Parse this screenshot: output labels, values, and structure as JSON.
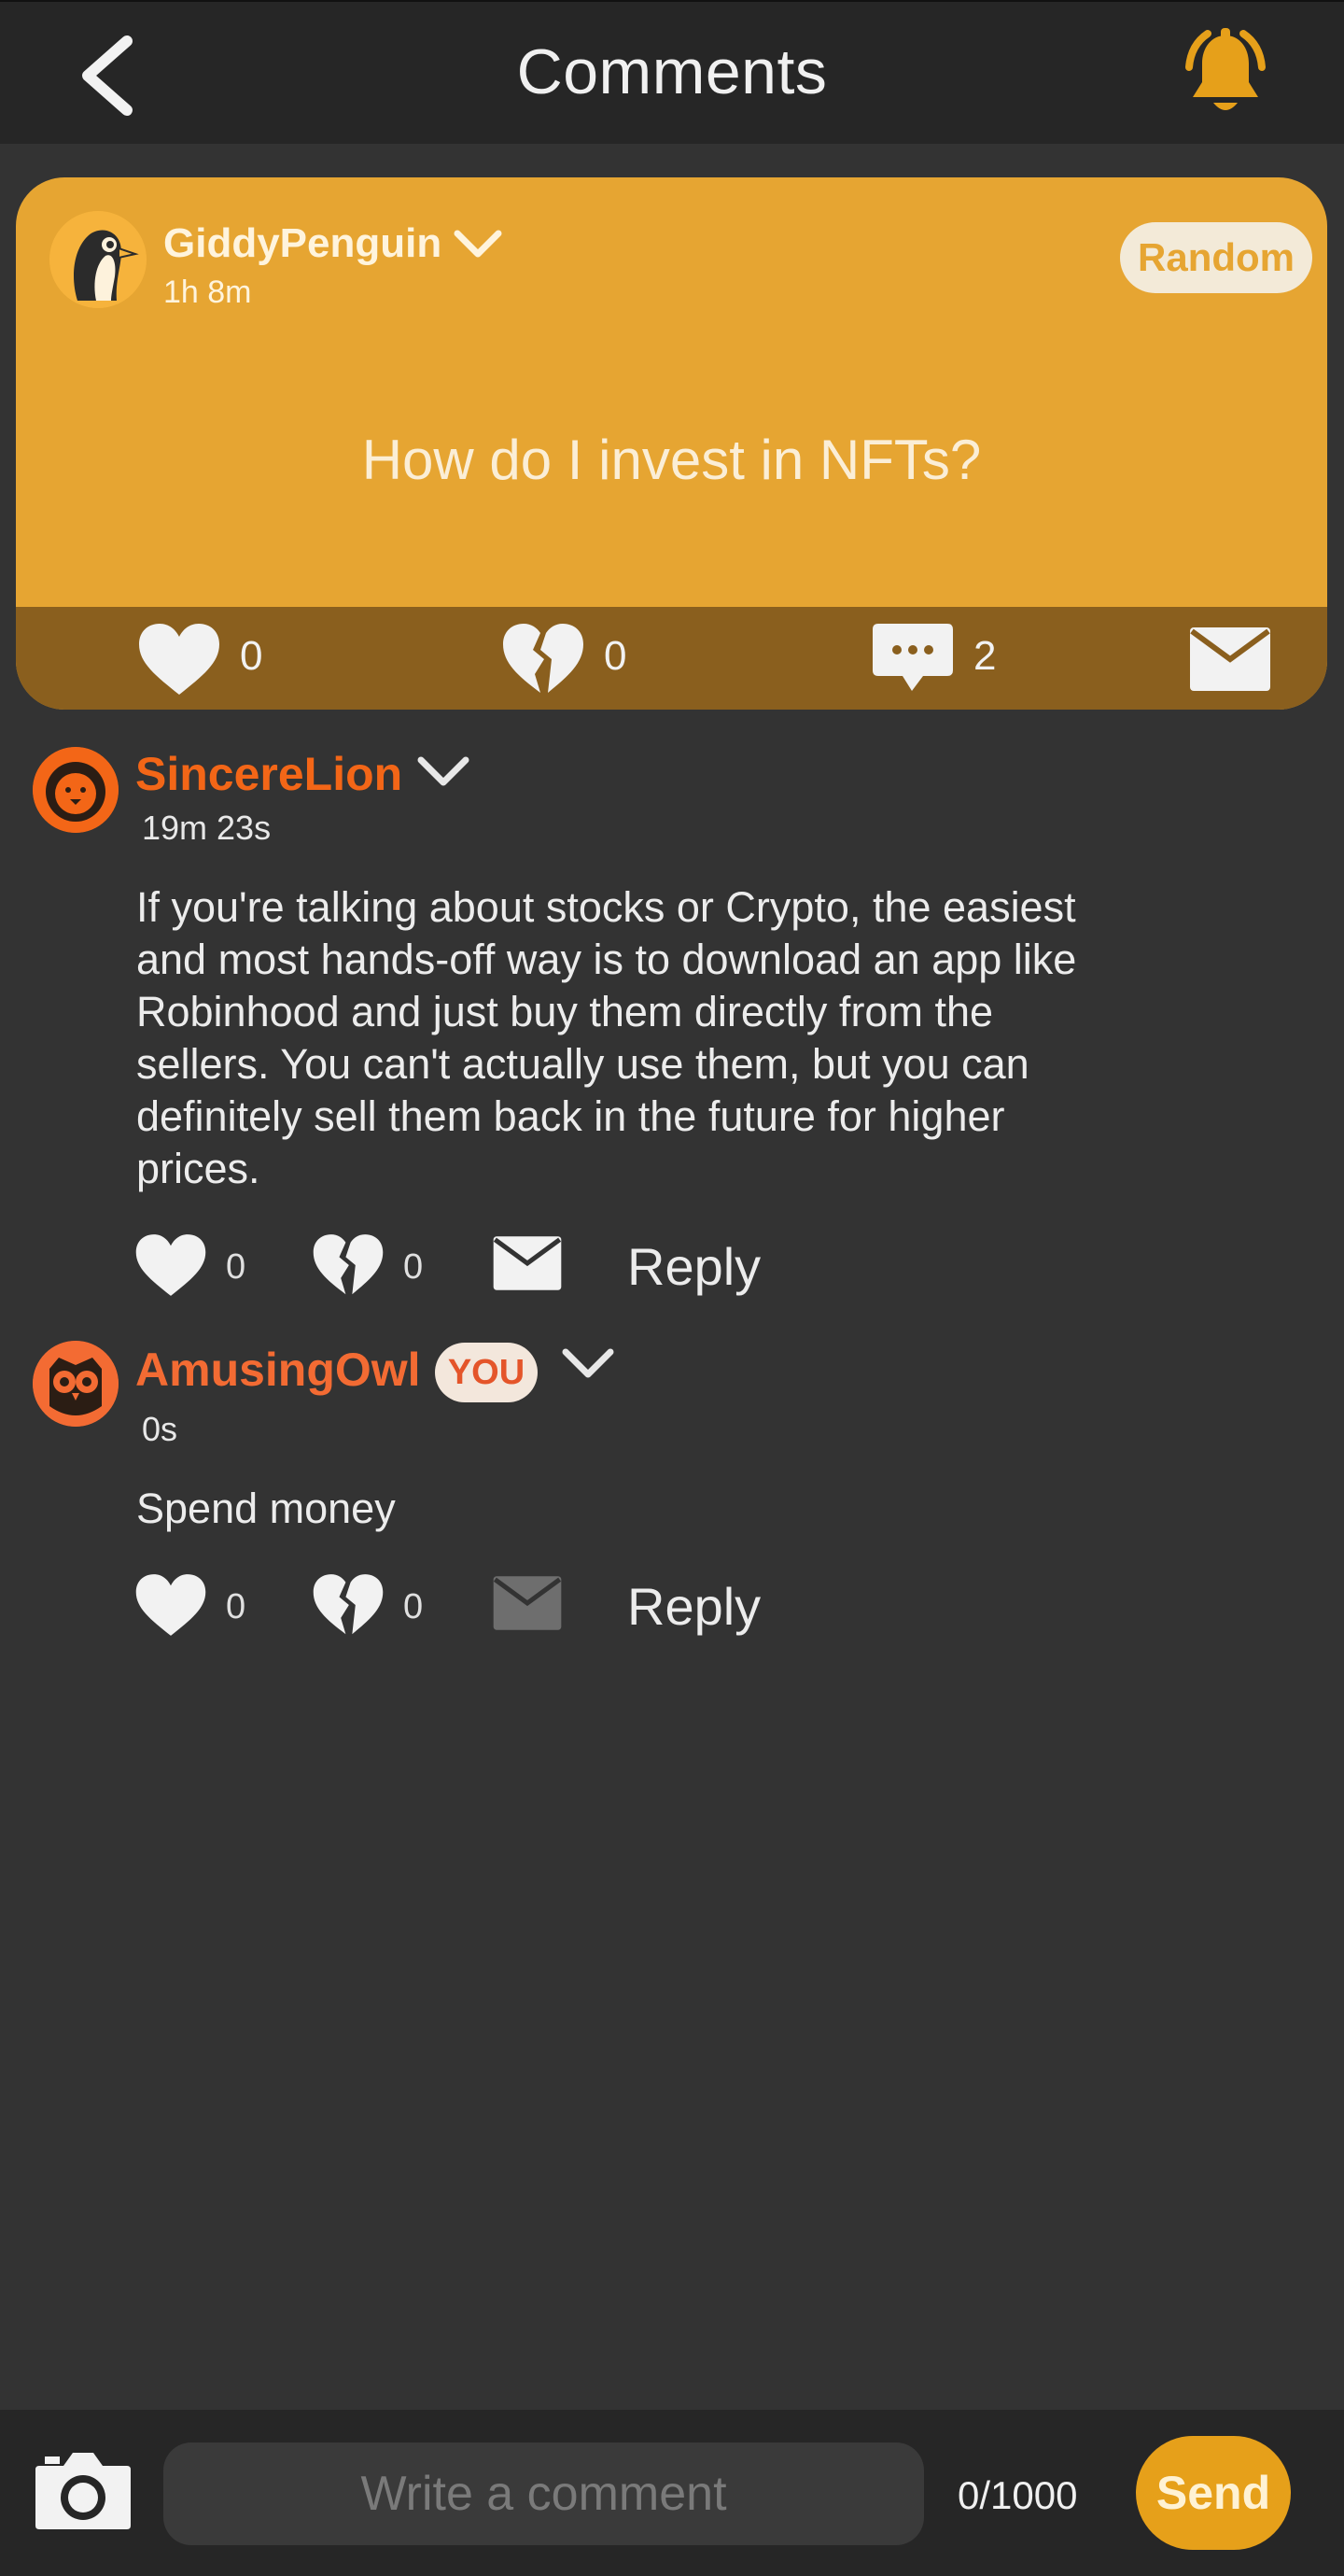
{
  "header": {
    "title": "Comments",
    "back_icon": "chevron-left-icon",
    "notification_icon": "bell-icon",
    "accent": "#e6a01a"
  },
  "post": {
    "username": "GiddyPenguin",
    "time": "1h 8m",
    "badge": "Random",
    "question": "How do I invest in NFTs?",
    "likes": "0",
    "dislikes": "0",
    "comments": "2",
    "card_color": "#e6a532",
    "action_bar_color": "#8a5f1e"
  },
  "comments": [
    {
      "username": "SincereLion",
      "time": "19m 23s",
      "text": "If you're talking about stocks or Crypto, the easiest and most hands-off way is to download an app like Robinhood and just buy them directly from the sellers. You can't actually use them, but you can definitely sell them back in the future for higher prices.",
      "likes": "0",
      "dislikes": "0",
      "reply_label": "Reply",
      "name_color": "#f36617"
    },
    {
      "username": "AmusingOwl",
      "you_badge": "YOU",
      "time": "0s",
      "text": "Spend money",
      "likes": "0",
      "dislikes": "0",
      "reply_label": "Reply",
      "name_color": "#f36b33"
    }
  ],
  "composer": {
    "placeholder": "Write a comment",
    "value": "",
    "char_count": "0/1000",
    "send_label": "Send"
  }
}
